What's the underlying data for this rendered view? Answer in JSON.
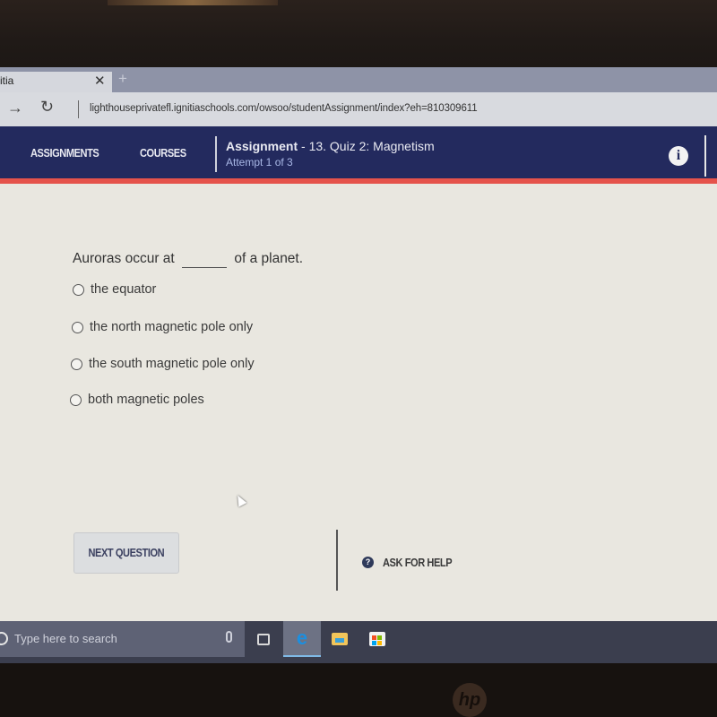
{
  "browser": {
    "tab_title": "itia",
    "tab_close": "✕",
    "new_tab": "+",
    "url": "lighthouseprivatefl.ignitiaschools.com/owsoo/studentAssignment/index?eh=810309611",
    "forward_icon": "→",
    "refresh_icon": "↻"
  },
  "nav": {
    "assignments": "ASSIGNMENTS",
    "courses": "COURSES",
    "assignment_label": "Assignment",
    "assignment_name": " - 13. Quiz 2: Magnetism",
    "attempt": "Attempt 1 of 3",
    "info_icon": "i",
    "accent_color": "#e5534b",
    "bar_color": "#232a5e"
  },
  "question": {
    "prefix": "Auroras occur at",
    "suffix": "of a planet.",
    "options": [
      {
        "label": "the equator",
        "selected": false
      },
      {
        "label": "the north magnetic pole only",
        "selected": false
      },
      {
        "label": "the south magnetic pole only",
        "selected": false
      },
      {
        "label": "both magnetic poles",
        "selected": false
      }
    ]
  },
  "actions": {
    "next_question": "NEXT QUESTION",
    "help_icon": "?",
    "ask_for_help": "ASK FOR HELP"
  },
  "taskbar": {
    "search_placeholder": "Type here to search",
    "edge_icon": "e"
  },
  "device": {
    "logo": "hp"
  }
}
